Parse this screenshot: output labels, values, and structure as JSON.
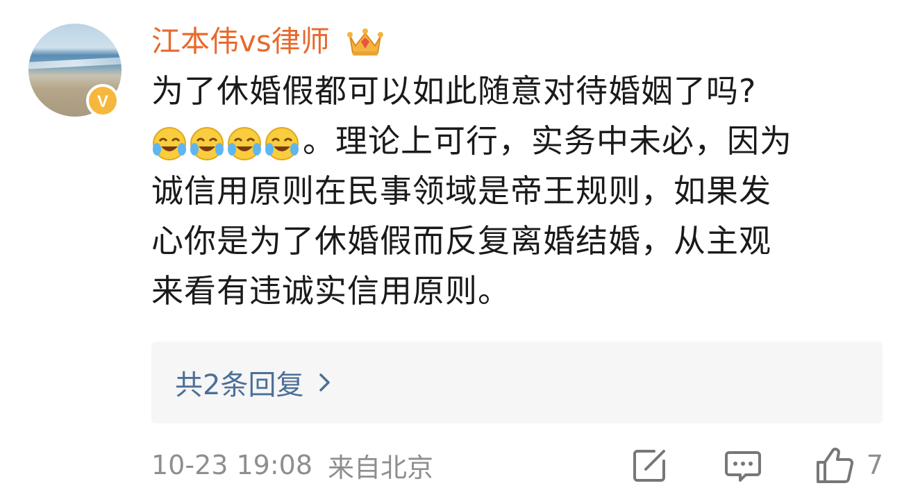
{
  "user": {
    "name": "江本伟vs律师",
    "avatar_icon": "beach-avatar",
    "badge_icon": "verified-v-icon",
    "badge_letter": "V",
    "member_icon": "crown-icon"
  },
  "comment": {
    "lines": [
      "为了休婚假都可以如此随意对待婚姻了吗?",
      "。理论上可行，实务中未必，因为",
      "诚信用原则在民事领域是帝王规则，如果发",
      "心你是为了休婚假而反复离婚结婚，从主观",
      "来看有违诚实信用原则。"
    ],
    "emoji_icon": "laugh-cry-emoji",
    "emoji_count": 4
  },
  "replies": {
    "label": "共2条回复"
  },
  "meta": {
    "time": "10-23 19:08",
    "location": "来自北京"
  },
  "actions": {
    "like_count": "7"
  },
  "colors": {
    "username": "#e8692b",
    "link": "#4c6f97",
    "meta": "#8e8e8e",
    "badge": "#f6b73c"
  }
}
